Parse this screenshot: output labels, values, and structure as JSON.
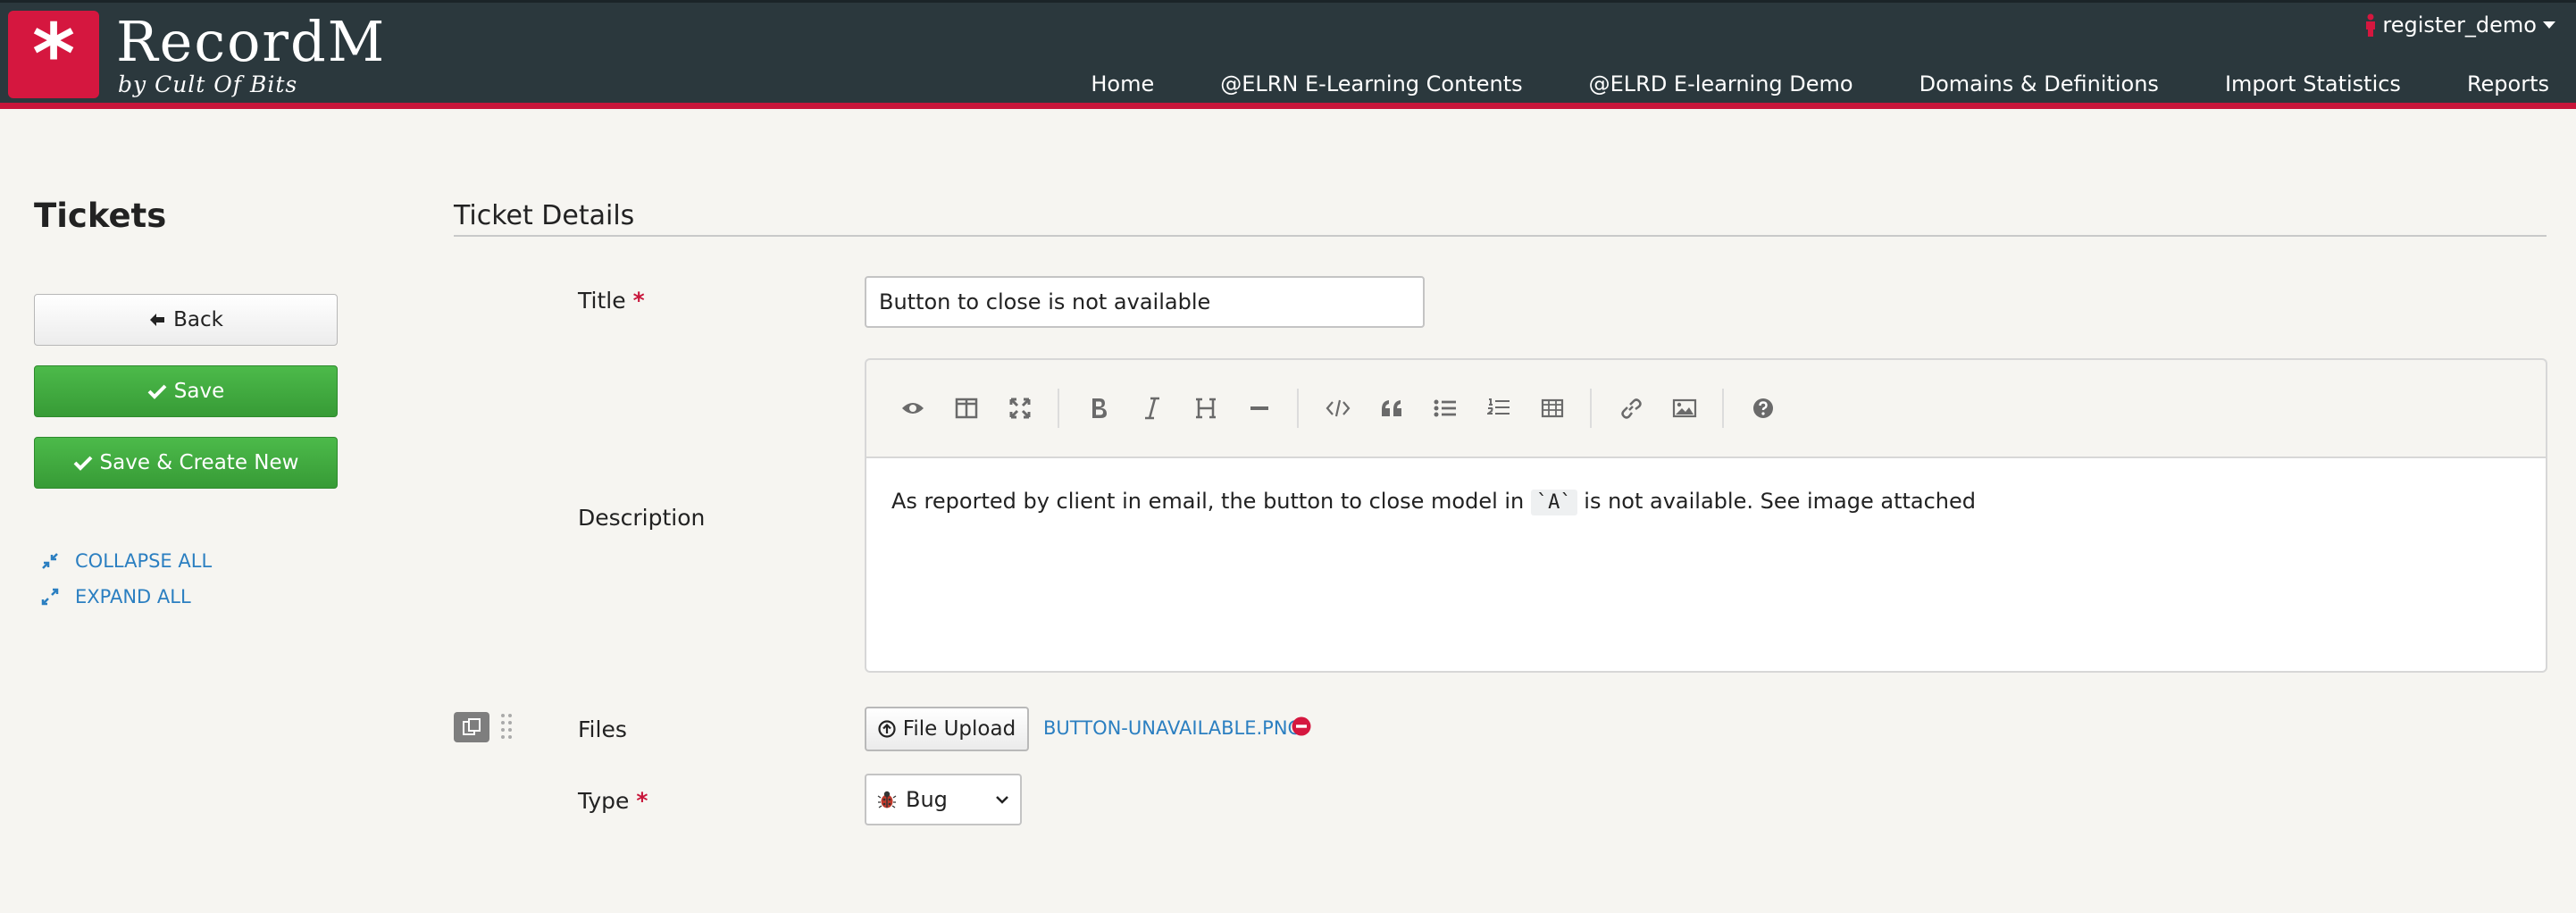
{
  "app": {
    "logo_glyph": "*",
    "name": "RecordM",
    "subtitle": "by Cult Of Bits",
    "brand_color": "#d5173f",
    "header_color": "#2b383d"
  },
  "user": {
    "name": "register_demo"
  },
  "nav": {
    "items": [
      "Home",
      "@ELRN E-Learning Contents",
      "@ELRD E-learning Demo",
      "Domains & Definitions",
      "Import Statistics",
      "Reports"
    ]
  },
  "sidebar": {
    "title": "Tickets",
    "back_label": "Back",
    "save_label": "Save",
    "save_new_label": "Save & Create New",
    "collapse_label": "COLLAPSE ALL",
    "expand_label": "EXPAND ALL"
  },
  "form": {
    "section_title": "Ticket Details",
    "title_label": "Title",
    "title_value": "Button to close is not available",
    "required_mark": "*",
    "description_label": "Description",
    "description_before": "As reported by client in email, the button to close model in ",
    "description_code": "`A`",
    "description_after": " is not available. See image attached",
    "files_label": "Files",
    "upload_label": "File Upload",
    "file_name": "BUTTON-UNAVAILABLE.PNG",
    "type_label": "Type",
    "type_value": "Bug"
  },
  "toolbar_icons": [
    "preview-icon",
    "side-by-side-icon",
    "fullscreen-icon",
    "bold-icon",
    "italic-icon",
    "heading-icon",
    "horizontal-rule-icon",
    "code-icon",
    "quote-icon",
    "unordered-list-icon",
    "ordered-list-icon",
    "table-icon",
    "link-icon",
    "image-icon",
    "help-icon"
  ]
}
